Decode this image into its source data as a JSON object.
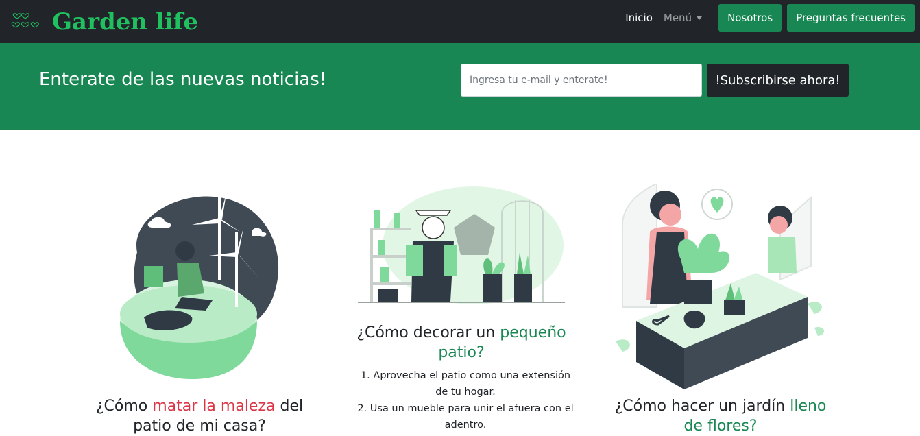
{
  "navbar": {
    "brand": "Garden life",
    "logo_icon": "hearts-icon",
    "links": {
      "inicio": "Inicio",
      "menu": "Menú"
    },
    "buttons": {
      "nosotros": "Nosotros",
      "faq": "Preguntas frecuentes"
    }
  },
  "banner": {
    "title": "Enterate de las nuevas noticias!",
    "email_placeholder": "Ingresa tu e-mail y enterate!",
    "subscribe_label": "!Subscribirse ahora!"
  },
  "cards": [
    {
      "title_pre": "¿Cómo ",
      "title_highlight": "matar la maleza",
      "title_post": " del patio de mi casa?",
      "highlight_color": "#dc3545"
    },
    {
      "title_pre": "¿Cómo decorar un ",
      "title_highlight": "pequeño patio?",
      "title_post": "",
      "highlight_color": "#198754",
      "list": [
        "1. Aprovecha el patio como una extensión de tu hogar.",
        "2. Usa un mueble para unir el afuera con el adentro."
      ]
    },
    {
      "title_pre": "¿Cómo hacer un jardín ",
      "title_highlight": "lleno de flores?",
      "title_post": "",
      "highlight_color": "#198754"
    }
  ],
  "colors": {
    "dark": "#212529",
    "green": "#198754",
    "brand_green": "#20c060",
    "light_green": "#a8e6b8"
  }
}
